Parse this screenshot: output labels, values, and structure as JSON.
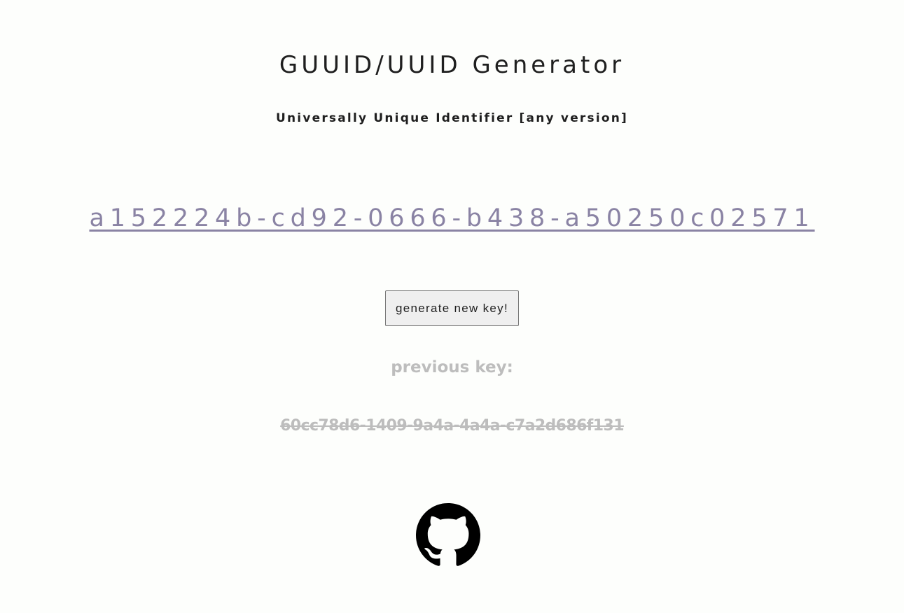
{
  "header": {
    "title": "GUUID/UUID Generator",
    "subtitle": "Universally Unique Identifier [any version]"
  },
  "current_key": "a152224b-cd92-0666-b438-a50250c02571",
  "actions": {
    "generate_label": "generate new key!"
  },
  "previous": {
    "label": "previous key:",
    "key": "60cc78d6-1409-9a4a-4a4a-c7a2d686f131"
  },
  "colors": {
    "background": "#fdfefc",
    "text": "#1f1f1f",
    "key_accent": "#8a83a4",
    "muted": "#bdbdbd"
  },
  "footer": {
    "icon": "github-icon"
  }
}
